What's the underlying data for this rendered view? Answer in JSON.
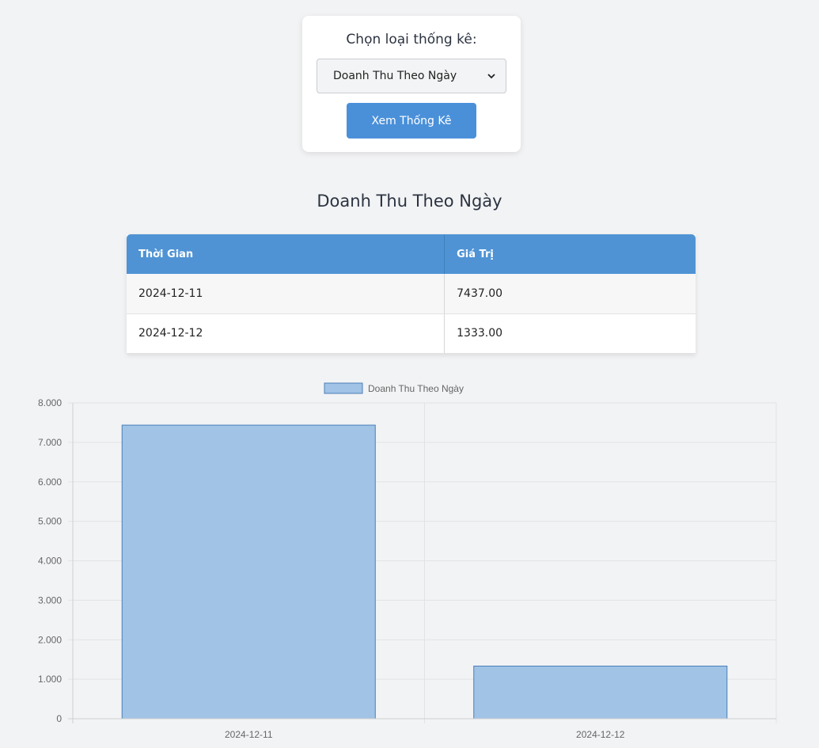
{
  "selector": {
    "label": "Chọn loại thống kê:",
    "selected": "Doanh Thu Theo Ngày",
    "button_label": "Xem Thống Kê"
  },
  "report": {
    "title": "Doanh Thu Theo Ngày",
    "columns": [
      "Thời Gian",
      "Giá Trị"
    ],
    "rows": [
      [
        "2024-12-11",
        "7437.00"
      ],
      [
        "2024-12-12",
        "1333.00"
      ]
    ]
  },
  "colors": {
    "accent": "#4a90d9",
    "header": "#4f93d4",
    "bar_fill": "#a0c3e6",
    "bar_stroke": "#4a7fb8",
    "background": "#f2f3f5"
  },
  "chart_data": {
    "type": "bar",
    "categories": [
      "2024-12-11",
      "2024-12-12"
    ],
    "series": [
      {
        "name": "Doanh Thu Theo Ngày",
        "values": [
          7437,
          1333
        ]
      }
    ],
    "ylim": [
      0,
      8000
    ],
    "yticks": [
      0,
      1000,
      2000,
      3000,
      4000,
      5000,
      6000,
      7000,
      8000
    ],
    "ytick_labels": [
      "0",
      "1.000",
      "2.000",
      "3.000",
      "4.000",
      "5.000",
      "6.000",
      "7.000",
      "8.000"
    ],
    "legend": "top",
    "grid": true
  }
}
